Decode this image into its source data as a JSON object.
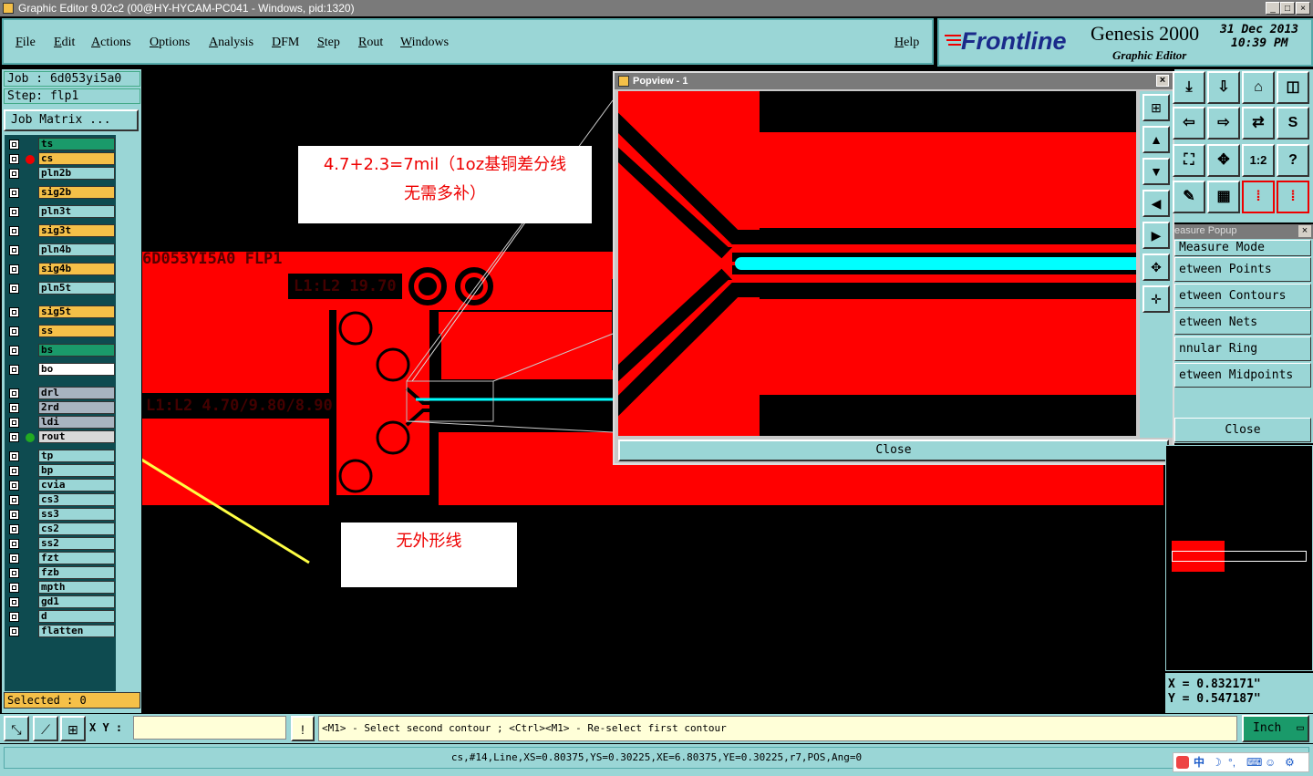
{
  "window": {
    "title": "Graphic Editor 9.02c2 (00@HY-HYCAM-PC041 - Windows, pid:1320)",
    "min": "_",
    "max": "□",
    "close": "×"
  },
  "menu": {
    "items": [
      "File",
      "Edit",
      "Actions",
      "Options",
      "Analysis",
      "DFM",
      "Step",
      "Rout",
      "Windows"
    ],
    "help": "Help"
  },
  "brand": {
    "logo": "Frontline",
    "product": "Genesis 2000",
    "subtitle": "Graphic Editor",
    "date": "31 Dec 2013",
    "time": "10:39 PM"
  },
  "job": {
    "job_label": "Job : 6d053yi5a0",
    "step_label": "Step: flp1",
    "matrix_button": "Job Matrix ..."
  },
  "layers": [
    {
      "name": "ts",
      "color": "#1a9a6a"
    },
    {
      "name": "cs",
      "color": "#f5c048",
      "marker": "#e00"
    },
    {
      "name": "pln2b",
      "color": "#9ad6d6"
    },
    {
      "name": "sig2b",
      "color": "#f5c048"
    },
    {
      "name": "pln3t",
      "color": "#9ad6d6"
    },
    {
      "name": "sig3t",
      "color": "#f5c048"
    },
    {
      "name": "pln4b",
      "color": "#9ad6d6"
    },
    {
      "name": "sig4b",
      "color": "#f5c048"
    },
    {
      "name": "pln5t",
      "color": "#9ad6d6"
    },
    {
      "name": "sig5t",
      "color": "#f5c048"
    },
    {
      "name": "ss",
      "color": "#f5c048"
    },
    {
      "name": "bs",
      "color": "#1a9a6a"
    },
    {
      "name": "bo",
      "color": "#ffffff"
    },
    {
      "name": "drl",
      "color": "#a8b4c0"
    },
    {
      "name": "2rd",
      "color": "#a8b4c0"
    },
    {
      "name": "ldi",
      "color": "#a8b4c0"
    },
    {
      "name": "rout",
      "color": "#d8d8d8",
      "marker": "#2a2"
    },
    {
      "name": "tp",
      "color": "#9ad6d6"
    },
    {
      "name": "bp",
      "color": "#9ad6d6"
    },
    {
      "name": "cvia",
      "color": "#9ad6d6"
    },
    {
      "name": "cs3",
      "color": "#9ad6d6"
    },
    {
      "name": "ss3",
      "color": "#9ad6d6"
    },
    {
      "name": "cs2",
      "color": "#9ad6d6"
    },
    {
      "name": "ss2",
      "color": "#9ad6d6"
    },
    {
      "name": "fzt",
      "color": "#9ad6d6"
    },
    {
      "name": "fzb",
      "color": "#9ad6d6"
    },
    {
      "name": "mpth",
      "color": "#9ad6d6"
    },
    {
      "name": "gd1",
      "color": "#9ad6d6"
    },
    {
      "name": "d",
      "color": "#9ad6d6"
    },
    {
      "name": "flatten",
      "color": "#9ad6d6"
    }
  ],
  "selected": "Selected : 0",
  "canvas": {
    "label_job": "6D053YI5A0 FLP1",
    "label_l1l2a": "L1:L2 19.70",
    "label_l1l2b": "L1:L2 4.70/9.80/8.90",
    "annotation1_line1": "4.7+2.3=7mil（1oz基铜差分线",
    "annotation1_line2": "无需多补）",
    "annotation2": "无外形线"
  },
  "popview": {
    "title": "Popview - 1",
    "close": "Close"
  },
  "measure": {
    "title": "easure Popup",
    "items": [
      "Measure Mode",
      "etween Points",
      "etween Contours",
      "etween Nets",
      "nnular Ring",
      "etween Midpoints"
    ],
    "close": "Close"
  },
  "coords": {
    "x": "X = 0.832171\"",
    "y": "Y = 0.547187\""
  },
  "cmd": {
    "xy_label": "X Y :",
    "xy_value": "",
    "message": "<M1> - Select second contour ; <Ctrl><M1> - Re-select first contour",
    "units": "Inch"
  },
  "status": {
    "text": "cs,#14,Line,XS=0.80375,YS=0.30225,XE=6.80375,YE=0.30225,r7,POS,Ang=0"
  },
  "tray": {
    "ime": "中"
  },
  "colors": {
    "copper": "#ff0000",
    "trace_highlight": "#00ffff",
    "panel": "#9ad6d6",
    "arrow": "#ffff44"
  }
}
